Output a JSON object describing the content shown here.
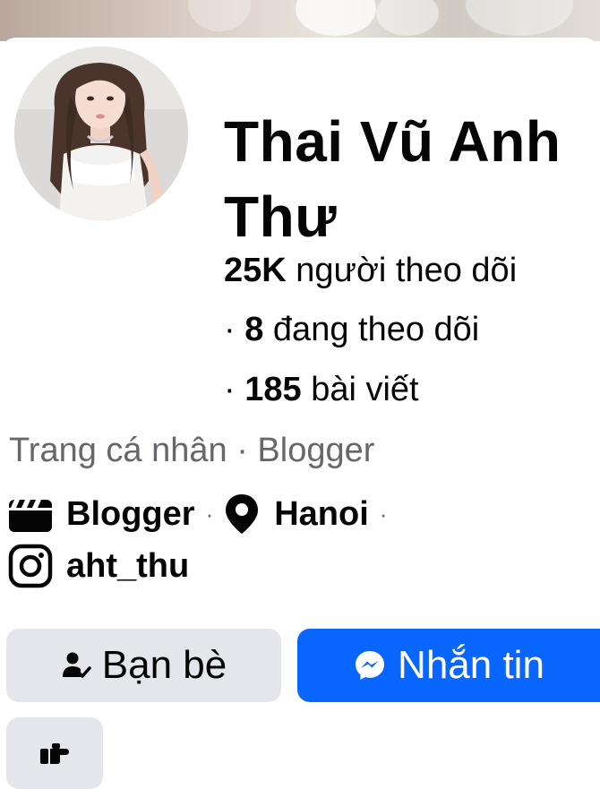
{
  "profile": {
    "name": "Thai Vũ Anh Thư",
    "followers_count": "25K",
    "followers_label": "người theo dõi",
    "following_prefix": "·",
    "following_count": "8",
    "following_label": "đang theo dõi",
    "posts_prefix": "·",
    "posts_count": "185",
    "posts_label": "bài viết",
    "category": "Trang cá nhân · Blogger"
  },
  "details": {
    "work": "Blogger",
    "location": "Hanoi",
    "instagram": "aht_thu",
    "separator": "·"
  },
  "actions": {
    "friends_label": "Bạn bè",
    "message_label": "Nhắn tin"
  },
  "icons": {
    "work": "clapperboard-icon",
    "location": "map-pin-icon",
    "instagram": "instagram-icon",
    "friends": "person-check-icon",
    "message": "messenger-icon",
    "poke": "poke-hand-icon"
  },
  "colors": {
    "primary": "#0866ff",
    "secondary_button": "#e4e6eb",
    "muted_text": "#65676b",
    "text": "#050505"
  }
}
